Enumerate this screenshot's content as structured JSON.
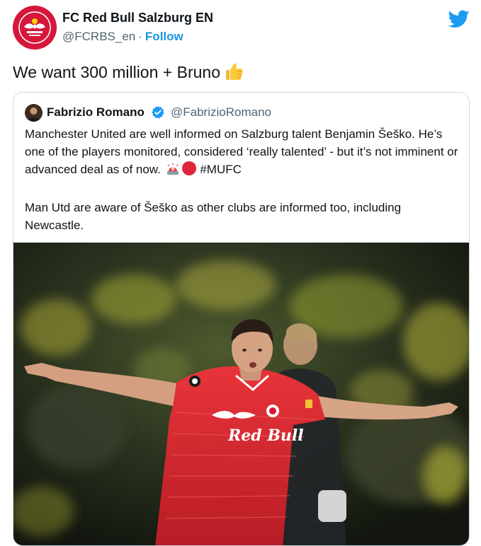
{
  "account": {
    "name": "FC Red Bull Salzburg EN",
    "handle": "@FCRBS_en",
    "separator": "·",
    "follow_label": "Follow",
    "avatar_icon": "red-bull-salzburg-crest",
    "brand_color": "#d6173b"
  },
  "tweet": {
    "text": "We want 300 million + Bruno",
    "emoji": "thumbs-up"
  },
  "quoted": {
    "name": "Fabrizio Romano",
    "handle": "@FabrizioRomano",
    "verified_icon": "verified-badge-icon",
    "paragraph1_text": "Manchester United are well informed on Salzburg talent Benjamin Šeško. He’s one of the players monitored, considered ‘really talented’ - but it’s not imminent or advanced deal as of now.",
    "paragraph1_emojis": [
      "police-light",
      "red-circle"
    ],
    "hashtag": "#MUFC",
    "paragraph2": "Man Utd are aware of Šeško as other clubs are informed too, including Newcastle.",
    "photo_subject": "player-celebration",
    "photo_jersey_text": "Red Bull"
  },
  "colors": {
    "link": "#1b95e0",
    "secondary_text": "#536471",
    "border": "#cfd9de",
    "twitter_blue": "#1d9bf0",
    "jersey_red": "#e1252e"
  }
}
